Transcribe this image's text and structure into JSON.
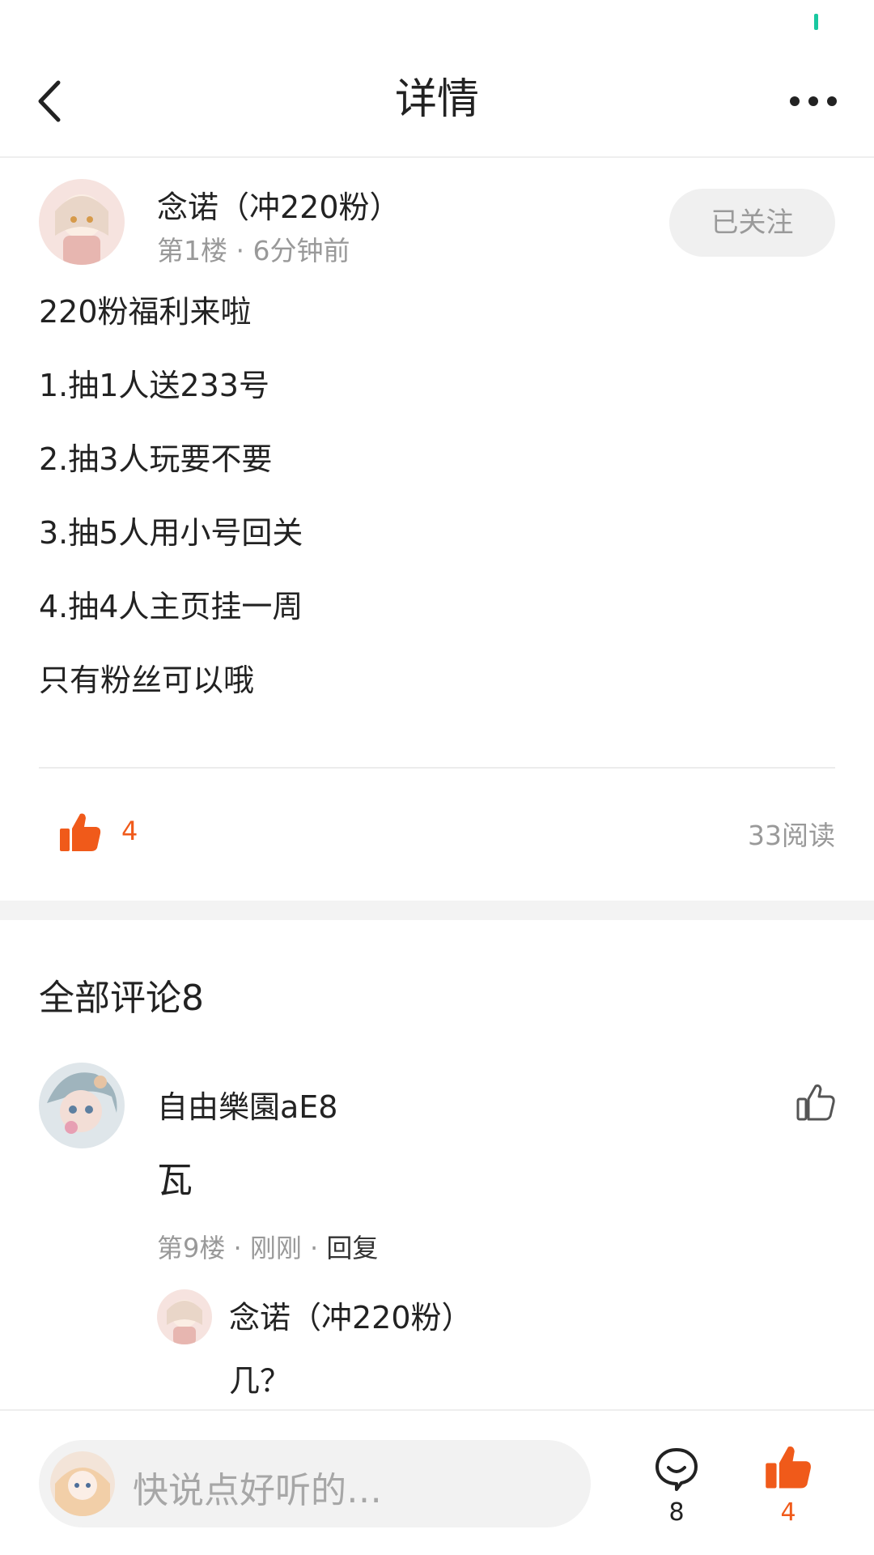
{
  "nav": {
    "title": "详情",
    "back_icon": "chevron-left-icon",
    "more_icon": "more-dots-icon"
  },
  "post": {
    "author_name": "念诺（冲220粉）",
    "meta": "第1楼 · 6分钟前",
    "follow_label": "已关注",
    "lines": [
      "220粉福利来啦",
      "1.抽1人送233号",
      "2.抽3人玩要不要",
      "3.抽5人用小号回关",
      "4.抽4人主页挂一周",
      "只有粉丝可以哦"
    ],
    "like_count": "4",
    "read_count": "33阅读"
  },
  "comments": {
    "title": "全部评论8",
    "items": [
      {
        "name": "自由樂園aE8",
        "text": "瓦",
        "meta": "第9楼 · 刚刚 · ",
        "reply_label": "回复",
        "reply": {
          "name": "念诺（冲220粉）",
          "text": "几？"
        }
      }
    ]
  },
  "bottom": {
    "placeholder": "快说点好听的…",
    "comment_count": "8",
    "like_count": "4"
  },
  "colors": {
    "accent": "#f05a1a",
    "muted": "#999999",
    "status": "#19c8a0"
  }
}
